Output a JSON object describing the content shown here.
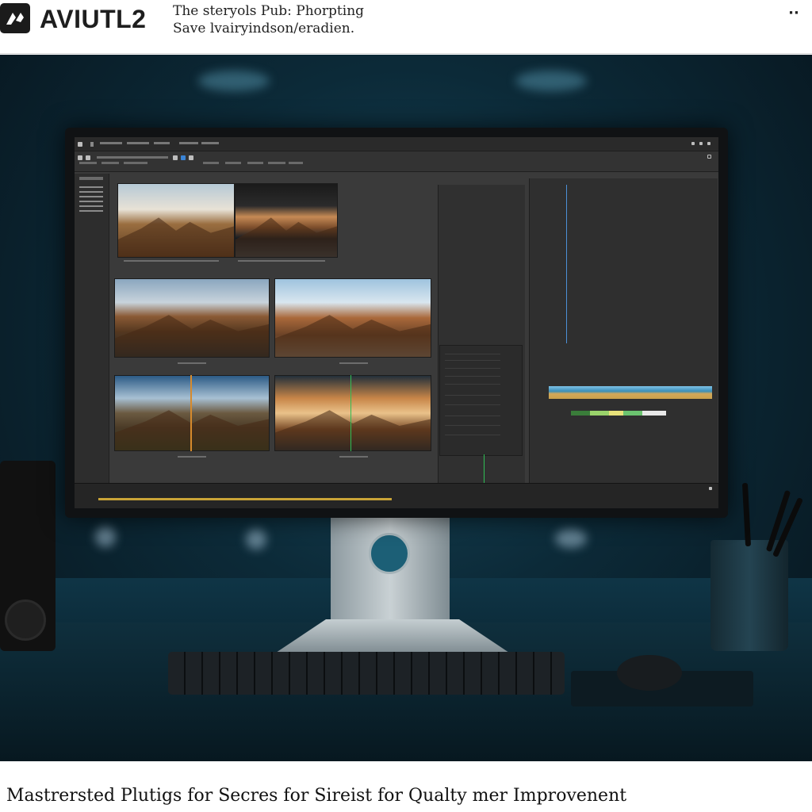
{
  "header": {
    "app_name": "AVIUTL2",
    "line1": "The steryols Pub: Phorpting",
    "line2": "Save lvairyindson/eradien.",
    "more_icon": "ellipsis-icon",
    "more_label": "··"
  },
  "screen": {
    "menu_items": [
      "",
      "",
      "",
      "",
      "",
      ""
    ],
    "captions": {
      "thumb1": "",
      "thumb2": "",
      "row2_left": "",
      "row2_right": "",
      "row3_left": "",
      "row3_right": ""
    }
  },
  "footer": {
    "title": "Mastrersted Plutigs for Secres for Sireist for Qualty mer Improvenent"
  },
  "colors": {
    "header_bg": "#ffffff",
    "scene_bg": "#0c2a38",
    "screen_bg": "#3a3a3a",
    "accent_blue": "#4c8fd6",
    "accent_green": "#2fbf55"
  }
}
